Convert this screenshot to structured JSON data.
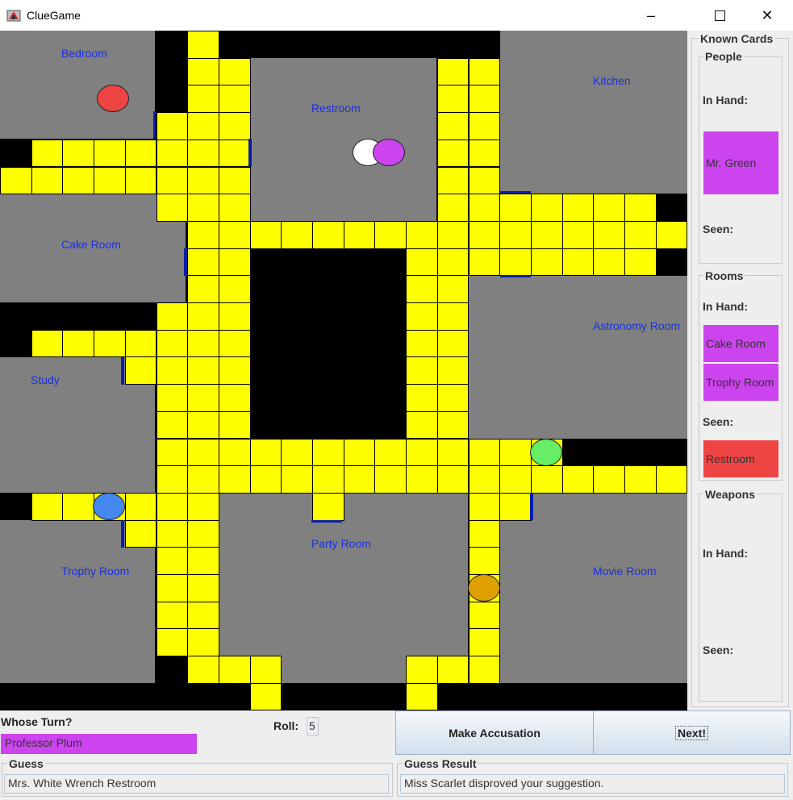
{
  "window": {
    "title": "ClueGame"
  },
  "board": {
    "rooms": [
      "Bedroom",
      "Restroom",
      "Kitchen",
      "Cake Room",
      "Astronomy Room",
      "Study",
      "Party Room",
      "Trophy Room",
      "Movie Room"
    ]
  },
  "colors": {
    "walkway": "#ffff00",
    "room": "#808080",
    "wall": "#000000",
    "door": "#0a1fa8",
    "label": "#1a2fe0",
    "card_hand": "#cc44ee",
    "card_seen": "#ee4444",
    "player_red": "#ee4444",
    "player_white": "#ffffff",
    "player_purple": "#cc44ee",
    "player_green": "#66ee66",
    "player_blue": "#4488ee",
    "player_orange": "#dda000"
  },
  "sidebar": {
    "title": "Known Cards",
    "people": {
      "legend": "People",
      "in_hand_label": "In Hand:",
      "in_hand": [
        "Mr. Green"
      ],
      "seen_label": "Seen:",
      "seen": []
    },
    "rooms": {
      "legend": "Rooms",
      "in_hand_label": "In Hand:",
      "in_hand": [
        "Cake Room",
        "Trophy Room"
      ],
      "seen_label": "Seen:",
      "seen": [
        "Restroom"
      ]
    },
    "weapons": {
      "legend": "Weapons",
      "in_hand_label": "In Hand:",
      "in_hand": [],
      "seen_label": "Seen:",
      "seen": []
    }
  },
  "controls": {
    "whose_turn_label": "Whose Turn?",
    "whose_turn_value": "Professor Plum",
    "roll_label": "Roll:",
    "roll_value": "5",
    "accuse_button": "Make Accusation",
    "next_button": "Next!",
    "guess_label": "Guess",
    "guess_value": "Mrs. White Wrench Restroom",
    "guess_result_label": "Guess Result",
    "guess_result_value": "Miss Scarlet disproved your suggestion."
  }
}
